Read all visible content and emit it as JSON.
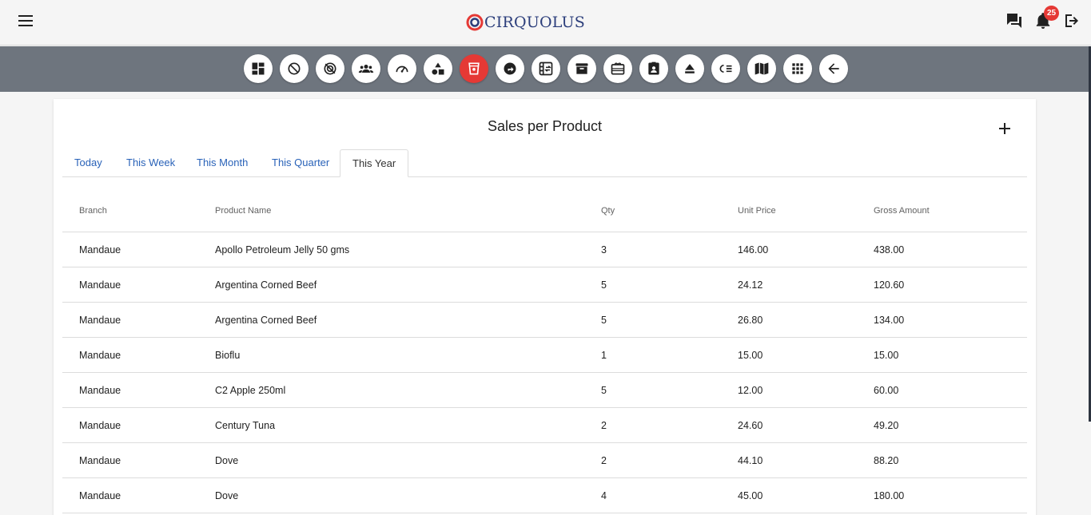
{
  "header": {
    "logo_text": "CIRQUOLUS",
    "notification_count": "25",
    "brand_red": "#e53935",
    "brand_blue": "#2c3e7b"
  },
  "toolbar": {
    "icons": [
      "dashboard-icon",
      "block-icon",
      "no-signal-icon",
      "groups-icon",
      "speed-icon",
      "shapes-icon",
      "cup-icon",
      "directions-icon",
      "swap-board-icon",
      "archive-icon",
      "gift-card-icon",
      "badge-icon",
      "eject-icon",
      "rule-icon",
      "map-book-icon",
      "apps-grid-icon",
      "back-arrow-icon"
    ],
    "active_index": 6
  },
  "page": {
    "title": "Sales per Product",
    "tabs": [
      "Today",
      "This Week",
      "This Month",
      "This Quarter",
      "This Year"
    ],
    "active_tab": "This Year"
  },
  "table": {
    "columns": [
      "Branch",
      "Product Name",
      "Qty",
      "Unit Price",
      "Gross Amount"
    ],
    "rows": [
      [
        "Mandaue",
        "Apollo Petroleum Jelly 50 gms",
        "3",
        "146.00",
        "438.00"
      ],
      [
        "Mandaue",
        "Argentina Corned Beef",
        "5",
        "24.12",
        "120.60"
      ],
      [
        "Mandaue",
        "Argentina Corned Beef",
        "5",
        "26.80",
        "134.00"
      ],
      [
        "Mandaue",
        "Bioflu",
        "1",
        "15.00",
        "15.00"
      ],
      [
        "Mandaue",
        "C2 Apple 250ml",
        "5",
        "12.00",
        "60.00"
      ],
      [
        "Mandaue",
        "Century Tuna",
        "2",
        "24.60",
        "49.20"
      ],
      [
        "Mandaue",
        "Dove",
        "2",
        "44.10",
        "88.20"
      ],
      [
        "Mandaue",
        "Dove",
        "4",
        "45.00",
        "180.00"
      ]
    ]
  }
}
